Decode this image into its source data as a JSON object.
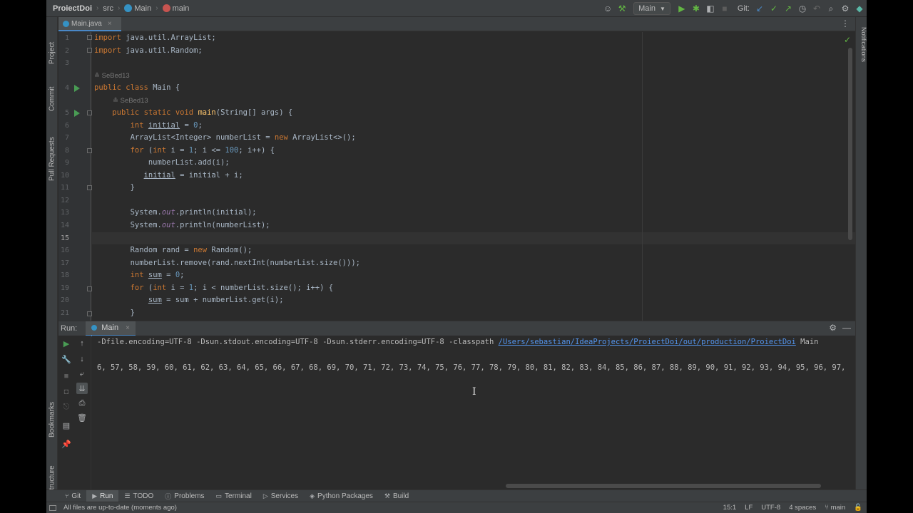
{
  "nav": {
    "project": "ProiectDoi",
    "folder": "src",
    "class_name": "Main",
    "method_name": "main",
    "run_config": "Main",
    "git_label": "Git:"
  },
  "left_tools": [
    "Project",
    "Commit",
    "Pull Requests",
    "Bookmarks",
    "Structure"
  ],
  "right_tools": [
    "Notifications"
  ],
  "editor": {
    "tab_label": "Main.java",
    "authors": [
      "SeBed13",
      "SeBed13"
    ],
    "line_numbers": [
      "1",
      "2",
      "3",
      "4",
      "5",
      "6",
      "7",
      "8",
      "9",
      "10",
      "11",
      "12",
      "13",
      "14",
      "15",
      "16",
      "17",
      "18",
      "19",
      "20",
      "21"
    ],
    "lines": [
      "import java.util.ArrayList;",
      "import java.util.Random;",
      "",
      "public class Main {",
      "    public static void main(String[] args) {",
      "        int initial = 0;",
      "        ArrayList<Integer> numberList = new ArrayList<>();",
      "        for (int i = 1; i <= 100; i++) {",
      "            numberList.add(i);",
      "           initial = initial + i;",
      "        }",
      "",
      "        System.out.println(initial);",
      "        System.out.println(numberList);",
      "",
      "        Random rand = new Random();",
      "        numberList.remove(rand.nextInt(numberList.size()));",
      "        int sum = 0;",
      "        for (int i = 1; i < numberList.size(); i++) {",
      "            sum = sum + numberList.get(i);",
      "        }"
    ]
  },
  "run_panel": {
    "label": "Run:",
    "tab": "Main",
    "cmd_prefix": "-Dfile.encoding=UTF-8 -Dsun.stdout.encoding=UTF-8 -Dsun.stderr.encoding=UTF-8 -classpath ",
    "cmd_path": "/Users/sebastian/IdeaProjects/ProiectDoi/out/production/ProiectDoi",
    "cmd_suffix": " Main",
    "output": "6, 57, 58, 59, 60, 61, 62, 63, 64, 65, 66, 67, 68, 69, 70, 71, 72, 73, 74, 75, 76, 77, 78, 79, 80, 81, 82, 83, 84, 85, 86, 87, 88, 89, 90, 91, 92, 93, 94, 95, 96, 97,"
  },
  "bottom_tabs": [
    "Git",
    "Run",
    "TODO",
    "Problems",
    "Terminal",
    "Services",
    "Python Packages",
    "Build"
  ],
  "status": {
    "message": "All files are up-to-date (moments ago)",
    "position": "15:1",
    "line_sep": "LF",
    "encoding": "UTF-8",
    "indent": "4 spaces",
    "branch": "main"
  },
  "colors": {
    "accent": "#4a88c7",
    "run_green": "#499c54",
    "keyword": "#cc7832",
    "number": "#6897bb",
    "function": "#ffc66d"
  }
}
